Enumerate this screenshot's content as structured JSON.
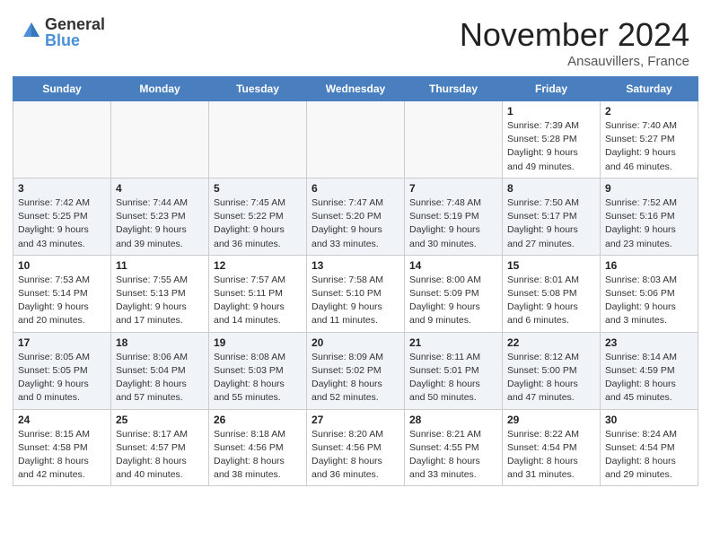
{
  "header": {
    "logo_general": "General",
    "logo_blue": "Blue",
    "month": "November 2024",
    "location": "Ansauvillers, France"
  },
  "weekdays": [
    "Sunday",
    "Monday",
    "Tuesday",
    "Wednesday",
    "Thursday",
    "Friday",
    "Saturday"
  ],
  "weeks": [
    [
      {
        "day": "",
        "info": ""
      },
      {
        "day": "",
        "info": ""
      },
      {
        "day": "",
        "info": ""
      },
      {
        "day": "",
        "info": ""
      },
      {
        "day": "",
        "info": ""
      },
      {
        "day": "1",
        "info": "Sunrise: 7:39 AM\nSunset: 5:28 PM\nDaylight: 9 hours\nand 49 minutes."
      },
      {
        "day": "2",
        "info": "Sunrise: 7:40 AM\nSunset: 5:27 PM\nDaylight: 9 hours\nand 46 minutes."
      }
    ],
    [
      {
        "day": "3",
        "info": "Sunrise: 7:42 AM\nSunset: 5:25 PM\nDaylight: 9 hours\nand 43 minutes."
      },
      {
        "day": "4",
        "info": "Sunrise: 7:44 AM\nSunset: 5:23 PM\nDaylight: 9 hours\nand 39 minutes."
      },
      {
        "day": "5",
        "info": "Sunrise: 7:45 AM\nSunset: 5:22 PM\nDaylight: 9 hours\nand 36 minutes."
      },
      {
        "day": "6",
        "info": "Sunrise: 7:47 AM\nSunset: 5:20 PM\nDaylight: 9 hours\nand 33 minutes."
      },
      {
        "day": "7",
        "info": "Sunrise: 7:48 AM\nSunset: 5:19 PM\nDaylight: 9 hours\nand 30 minutes."
      },
      {
        "day": "8",
        "info": "Sunrise: 7:50 AM\nSunset: 5:17 PM\nDaylight: 9 hours\nand 27 minutes."
      },
      {
        "day": "9",
        "info": "Sunrise: 7:52 AM\nSunset: 5:16 PM\nDaylight: 9 hours\nand 23 minutes."
      }
    ],
    [
      {
        "day": "10",
        "info": "Sunrise: 7:53 AM\nSunset: 5:14 PM\nDaylight: 9 hours\nand 20 minutes."
      },
      {
        "day": "11",
        "info": "Sunrise: 7:55 AM\nSunset: 5:13 PM\nDaylight: 9 hours\nand 17 minutes."
      },
      {
        "day": "12",
        "info": "Sunrise: 7:57 AM\nSunset: 5:11 PM\nDaylight: 9 hours\nand 14 minutes."
      },
      {
        "day": "13",
        "info": "Sunrise: 7:58 AM\nSunset: 5:10 PM\nDaylight: 9 hours\nand 11 minutes."
      },
      {
        "day": "14",
        "info": "Sunrise: 8:00 AM\nSunset: 5:09 PM\nDaylight: 9 hours\nand 9 minutes."
      },
      {
        "day": "15",
        "info": "Sunrise: 8:01 AM\nSunset: 5:08 PM\nDaylight: 9 hours\nand 6 minutes."
      },
      {
        "day": "16",
        "info": "Sunrise: 8:03 AM\nSunset: 5:06 PM\nDaylight: 9 hours\nand 3 minutes."
      }
    ],
    [
      {
        "day": "17",
        "info": "Sunrise: 8:05 AM\nSunset: 5:05 PM\nDaylight: 9 hours\nand 0 minutes."
      },
      {
        "day": "18",
        "info": "Sunrise: 8:06 AM\nSunset: 5:04 PM\nDaylight: 8 hours\nand 57 minutes."
      },
      {
        "day": "19",
        "info": "Sunrise: 8:08 AM\nSunset: 5:03 PM\nDaylight: 8 hours\nand 55 minutes."
      },
      {
        "day": "20",
        "info": "Sunrise: 8:09 AM\nSunset: 5:02 PM\nDaylight: 8 hours\nand 52 minutes."
      },
      {
        "day": "21",
        "info": "Sunrise: 8:11 AM\nSunset: 5:01 PM\nDaylight: 8 hours\nand 50 minutes."
      },
      {
        "day": "22",
        "info": "Sunrise: 8:12 AM\nSunset: 5:00 PM\nDaylight: 8 hours\nand 47 minutes."
      },
      {
        "day": "23",
        "info": "Sunrise: 8:14 AM\nSunset: 4:59 PM\nDaylight: 8 hours\nand 45 minutes."
      }
    ],
    [
      {
        "day": "24",
        "info": "Sunrise: 8:15 AM\nSunset: 4:58 PM\nDaylight: 8 hours\nand 42 minutes."
      },
      {
        "day": "25",
        "info": "Sunrise: 8:17 AM\nSunset: 4:57 PM\nDaylight: 8 hours\nand 40 minutes."
      },
      {
        "day": "26",
        "info": "Sunrise: 8:18 AM\nSunset: 4:56 PM\nDaylight: 8 hours\nand 38 minutes."
      },
      {
        "day": "27",
        "info": "Sunrise: 8:20 AM\nSunset: 4:56 PM\nDaylight: 8 hours\nand 36 minutes."
      },
      {
        "day": "28",
        "info": "Sunrise: 8:21 AM\nSunset: 4:55 PM\nDaylight: 8 hours\nand 33 minutes."
      },
      {
        "day": "29",
        "info": "Sunrise: 8:22 AM\nSunset: 4:54 PM\nDaylight: 8 hours\nand 31 minutes."
      },
      {
        "day": "30",
        "info": "Sunrise: 8:24 AM\nSunset: 4:54 PM\nDaylight: 8 hours\nand 29 minutes."
      }
    ]
  ]
}
